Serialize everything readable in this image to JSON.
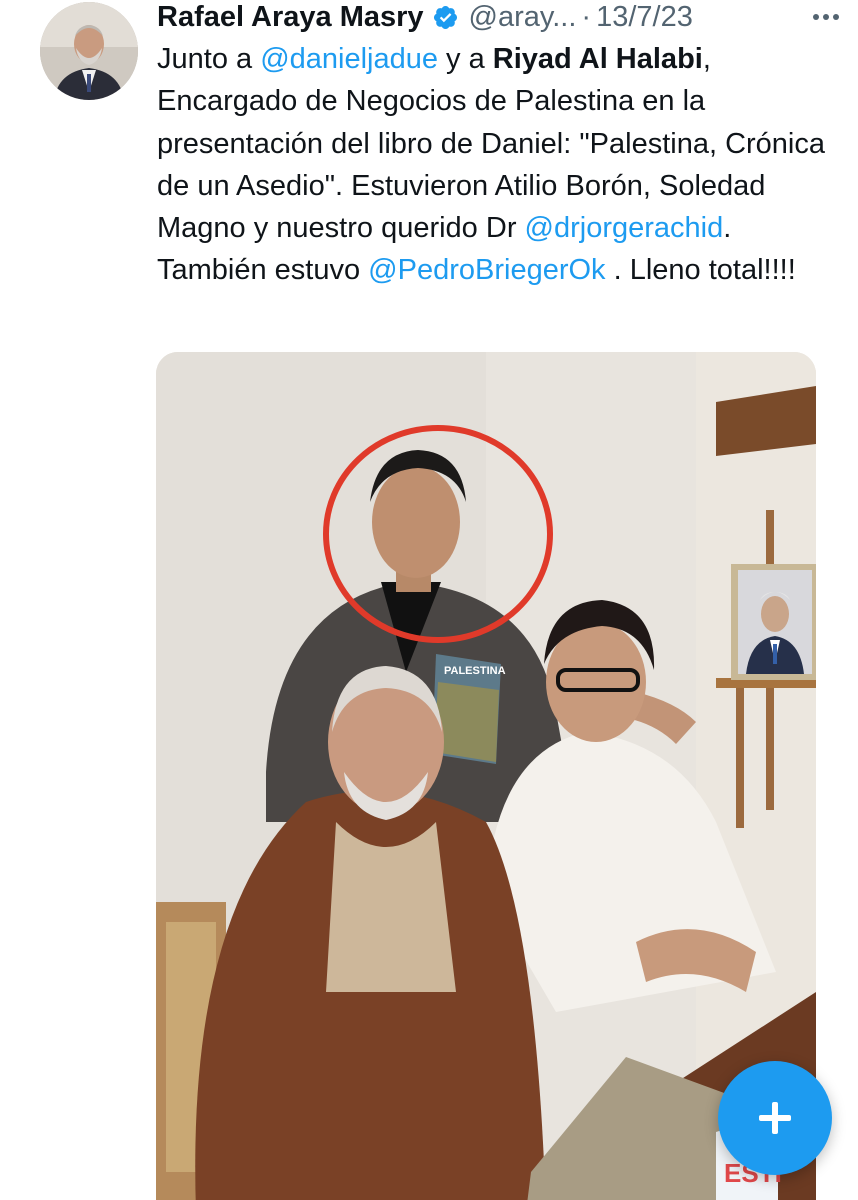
{
  "tweet": {
    "author_name": "Rafael Araya Masry",
    "handle": "@aray...",
    "separator": "·",
    "date": "13/7/23",
    "text": {
      "t1": "Junto a ",
      "m1": "@danieljadue",
      "t2": " y a ",
      "b1": "Riyad Al Halabi",
      "t3": ", Encargado de Negocios de Palestina en la presentación del libro de Daniel: \"Palestina, Crónica de un Asedio\". Estuvieron Atilio Borón, Soledad Magno y nuestro querido Dr ",
      "m2": "@drjorgerachid",
      "t4": ". También  estuvo ",
      "m3": "@PedroBriegerOk",
      "t5": " . Lleno total!!!!"
    }
  },
  "photo": {
    "book_title": "PALESTINA",
    "book_spine_text": "ESTI",
    "highlight_color": "#e03a2a"
  },
  "icons": {
    "verified": "verified-badge-icon",
    "more": "more-options-icon",
    "compose": "plus-icon"
  },
  "colors": {
    "accent": "#1d9bf0",
    "secondary_text": "#536471",
    "primary_text": "#0f1419"
  }
}
